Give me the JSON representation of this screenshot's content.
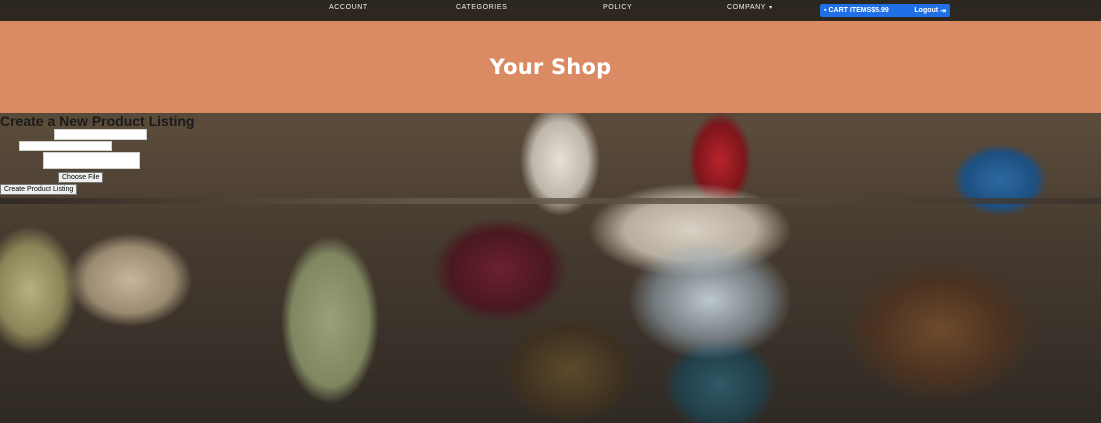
{
  "nav": {
    "account": "ACCOUNT",
    "categories": "CATEGORIES",
    "policy": "POLICY",
    "company": "COMPANY",
    "company_caret": "▾",
    "cart_label": "CART ITEMS$5.99",
    "logout_label": "Logout"
  },
  "hero": {
    "title": "Your Shop"
  },
  "form": {
    "heading": "Create a New Product Listing",
    "submit_label": "Create Product Listing",
    "file_button": "Choose File"
  },
  "colors": {
    "hero_bg": "#db8b63",
    "cart_bg": "#1f6fe6"
  },
  "icons": {
    "cart": "cart-icon",
    "logout": "logout-icon"
  }
}
